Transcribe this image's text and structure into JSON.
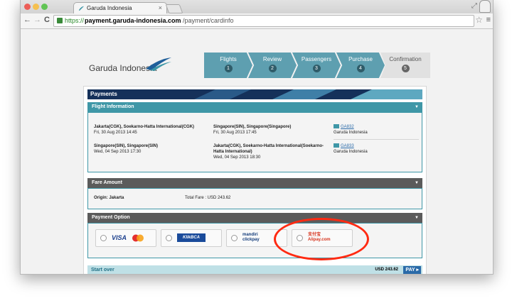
{
  "browser": {
    "tab_title": "Garuda Indonesia",
    "tab_close": "×",
    "url_scheme": "https://",
    "url_host": "payment.garuda-indonesia.com",
    "url_path": "/payment/cardinfo",
    "back": "←",
    "forward": "→",
    "reload": "C",
    "star": "☆",
    "menu": "≡",
    "resize": "⤢"
  },
  "brand": {
    "name": "Garuda Indonesia"
  },
  "steps": [
    {
      "label": "Flights",
      "num": "1"
    },
    {
      "label": "Review",
      "num": "2"
    },
    {
      "label": "Passengers",
      "num": "3"
    },
    {
      "label": "Purchase",
      "num": "4"
    },
    {
      "label": "Confirmation",
      "num": "5"
    }
  ],
  "payments_title": "Payments",
  "flight_info": {
    "title": "Flight Information",
    "arrow": "▼",
    "rows": [
      {
        "origin": "Jakarta(CGK), Soekarno-Hatta International(CGK)",
        "depart": "Fri, 30 Aug 2013 14:45",
        "destination": "Singapore(SIN), Singapore(Singapore)",
        "arrive": "Fri, 30 Aug 2013 17:45",
        "flight_no": "GA832",
        "carrier": "Garuda Indonesia"
      },
      {
        "origin": "Singapore(SIN), Singapore(SIN)",
        "depart": "Wed, 04 Sep 2013 17:30",
        "destination": "Jakarta(CGK), Soekarno-Hatta International(Soekarno-",
        "destination2": "Hatta International)",
        "arrive": "Wed, 04 Sep 2013 18:30",
        "flight_no": "GA833",
        "carrier": "Garuda Indonesia"
      }
    ]
  },
  "fare": {
    "title": "Fare Amount",
    "arrow": "▼",
    "origin_label": "Origin: Jakarta",
    "total_label": "Total Fare : USD 243.62"
  },
  "payment_option": {
    "title": "Payment Option",
    "arrow": "▼",
    "options": [
      "VISA",
      "KlikBCA",
      "mandiri clickpay",
      "支付宝 Alipay.com"
    ]
  },
  "footer": {
    "start_over": "Start over",
    "amount": "USD 243.62",
    "pay": "PAY"
  },
  "colors": {
    "teal": "#3f97a7",
    "navy": "#15315a",
    "highlight": "#ff2a12"
  }
}
